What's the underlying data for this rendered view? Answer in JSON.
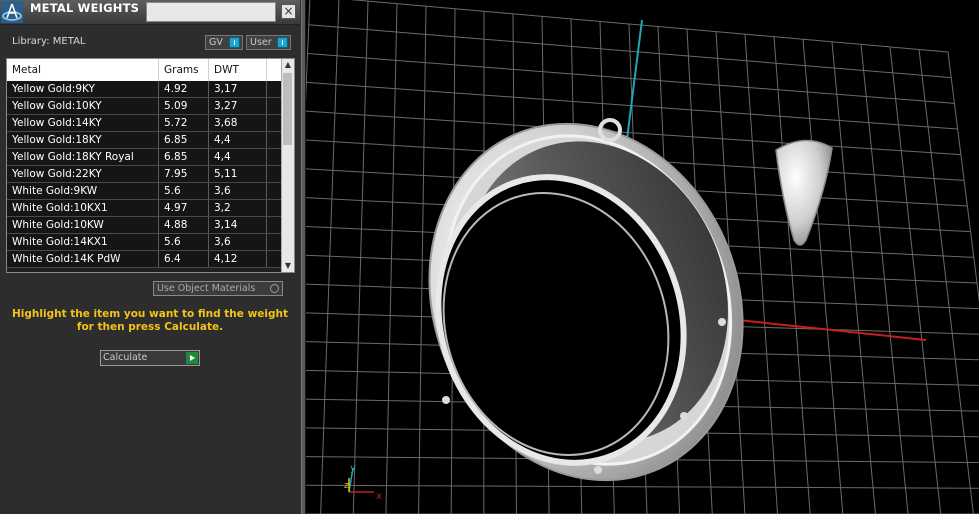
{
  "panel": {
    "title": "METAL WEIGHTS",
    "close_glyph": "×",
    "library_label": "Library: METAL",
    "toggles": {
      "gv": "GV",
      "user": "User"
    },
    "table": {
      "columns": [
        "Metal",
        "Grams",
        "DWT"
      ],
      "rows": [
        [
          "Yellow Gold:9KY",
          "4.92",
          "3,17"
        ],
        [
          "Yellow Gold:10KY",
          "5.09",
          "3,27"
        ],
        [
          "Yellow Gold:14KY",
          "5.72",
          "3,68"
        ],
        [
          "Yellow Gold:18KY",
          "6.85",
          "4,4"
        ],
        [
          "Yellow Gold:18KY Royal",
          "6.85",
          "4,4"
        ],
        [
          "Yellow Gold:22KY",
          "7.95",
          "5,11"
        ],
        [
          "White Gold:9KW",
          "5.6",
          "3,6"
        ],
        [
          "White Gold:10KX1",
          "4.97",
          "3,2"
        ],
        [
          "White Gold:10KW",
          "4.88",
          "3,14"
        ],
        [
          "White Gold:14KX1",
          "5.6",
          "3,6"
        ],
        [
          "White Gold:14K PdW",
          "6.4",
          "4,12"
        ]
      ]
    },
    "use_object_materials": "Use Object Materials",
    "instruction": "Highlight the item you want to find the weight for then press Calculate.",
    "calculate_label": "Calculate"
  },
  "viewport": {
    "axis_labels": {
      "x": "x",
      "y": "y",
      "z": "z"
    },
    "colors": {
      "x_axis": "#c81e1e",
      "y_axis": "#1fa8b4",
      "grid": "#6a6a6a"
    }
  }
}
